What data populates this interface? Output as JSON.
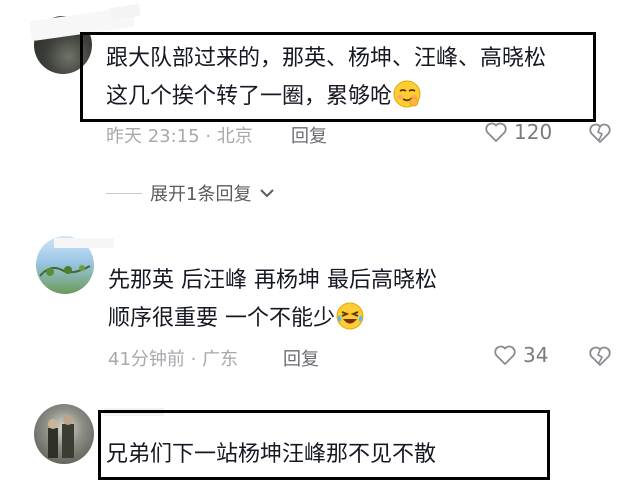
{
  "comments": [
    {
      "lines": [
        "跟大队部过来的，那英、杨坤、汪峰、高晓松",
        "这几个挨个转了一圈，累够呛"
      ],
      "emoji": "smirk-emoji",
      "time_location": "昨天 23:15 · 北京",
      "reply_label": "回复",
      "like_count": "120"
    },
    {
      "lines": [
        "先那英 后汪峰 再杨坤 最后高晓松",
        "顺序很重要 一个不能少"
      ],
      "emoji": "laughing-tears-emoji",
      "time_location": "41分钟前 · 广东",
      "reply_label": "回复",
      "like_count": "34"
    },
    {
      "lines": [
        "兄弟们下一站杨坤汪峰那不见不散"
      ]
    }
  ],
  "expand_replies_label": "展开1条回复",
  "colors": {
    "text": "#161823",
    "meta": "#a8a9ad",
    "box_border": "#000000"
  }
}
